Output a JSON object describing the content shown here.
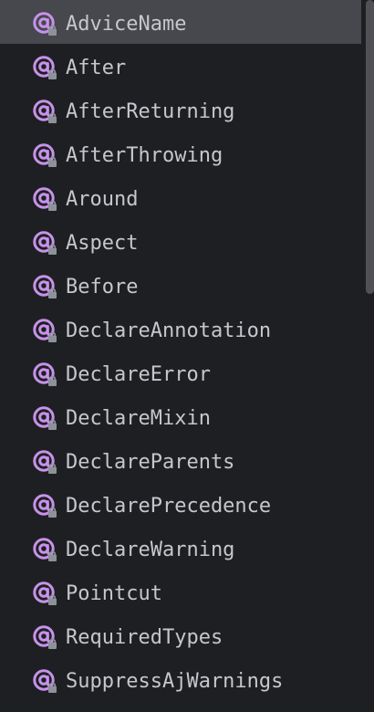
{
  "annotations": {
    "icon_name": "annotation-icon",
    "icon_color": "#c792ea",
    "lock_color": "#8d9199",
    "selected_index": 0,
    "items": [
      {
        "label": "AdviceName"
      },
      {
        "label": "After"
      },
      {
        "label": "AfterReturning"
      },
      {
        "label": "AfterThrowing"
      },
      {
        "label": "Around"
      },
      {
        "label": "Aspect"
      },
      {
        "label": "Before"
      },
      {
        "label": "DeclareAnnotation"
      },
      {
        "label": "DeclareError"
      },
      {
        "label": "DeclareMixin"
      },
      {
        "label": "DeclareParents"
      },
      {
        "label": "DeclarePrecedence"
      },
      {
        "label": "DeclareWarning"
      },
      {
        "label": "Pointcut"
      },
      {
        "label": "RequiredTypes"
      },
      {
        "label": "SuppressAjWarnings"
      }
    ]
  },
  "colors": {
    "background": "#1e1f22",
    "selection": "#46484d",
    "text": "#c5c7cc",
    "scrollbar": "#4f5155"
  }
}
